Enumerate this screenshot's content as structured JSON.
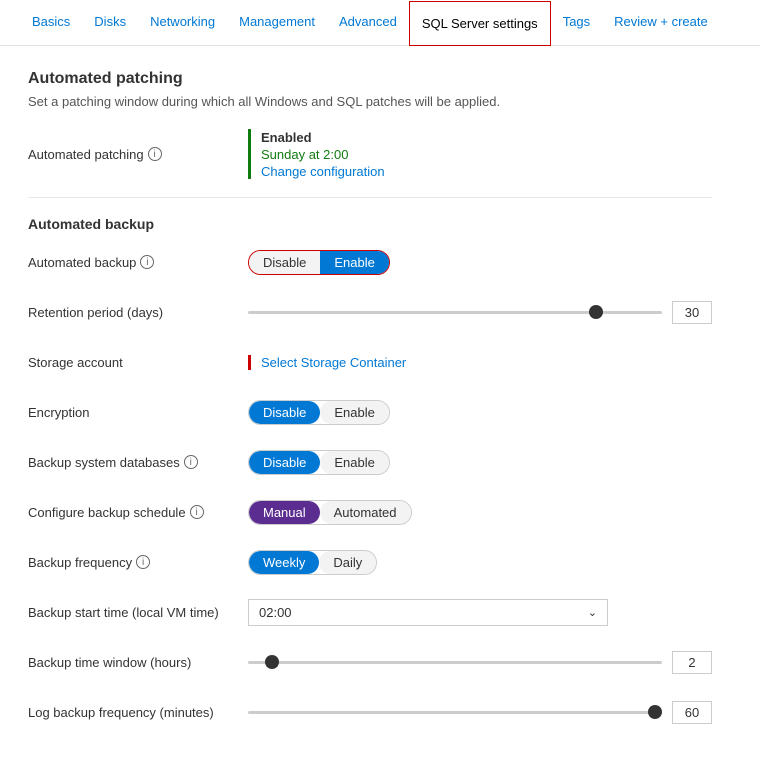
{
  "tabs": [
    {
      "id": "basics",
      "label": "Basics",
      "active": false
    },
    {
      "id": "disks",
      "label": "Disks",
      "active": false
    },
    {
      "id": "networking",
      "label": "Networking",
      "active": false
    },
    {
      "id": "management",
      "label": "Management",
      "active": false
    },
    {
      "id": "advanced",
      "label": "Advanced",
      "active": false
    },
    {
      "id": "sql-server-settings",
      "label": "SQL Server settings",
      "active": true
    },
    {
      "id": "tags",
      "label": "Tags",
      "active": false
    },
    {
      "id": "review-create",
      "label": "Review + create",
      "active": false
    }
  ],
  "automated_patching": {
    "section_title": "Automated patching",
    "section_desc": "Set a patching window during which all Windows and SQL patches will be applied.",
    "label": "Automated patching",
    "status": "Enabled",
    "schedule": "Sunday at 2:00",
    "change_link": "Change configuration"
  },
  "automated_backup": {
    "section_title": "Automated backup",
    "fields": {
      "backup_label": "Automated backup",
      "backup_disable": "Disable",
      "backup_enable": "Enable",
      "retention_label": "Retention period (days)",
      "retention_value": "30",
      "storage_label": "Storage account",
      "storage_link": "Select Storage Container",
      "encryption_label": "Encryption",
      "encryption_disable": "Disable",
      "encryption_enable": "Enable",
      "backup_system_label": "Backup system databases",
      "backup_system_disable": "Disable",
      "backup_system_enable": "Enable",
      "configure_label": "Configure backup schedule",
      "configure_manual": "Manual",
      "configure_automated": "Automated",
      "frequency_label": "Backup frequency",
      "frequency_weekly": "Weekly",
      "frequency_daily": "Daily",
      "start_time_label": "Backup start time (local VM time)",
      "start_time_value": "02:00",
      "time_window_label": "Backup time window (hours)",
      "time_window_value": "2",
      "log_freq_label": "Log backup frequency (minutes)",
      "log_freq_value": "60"
    }
  }
}
